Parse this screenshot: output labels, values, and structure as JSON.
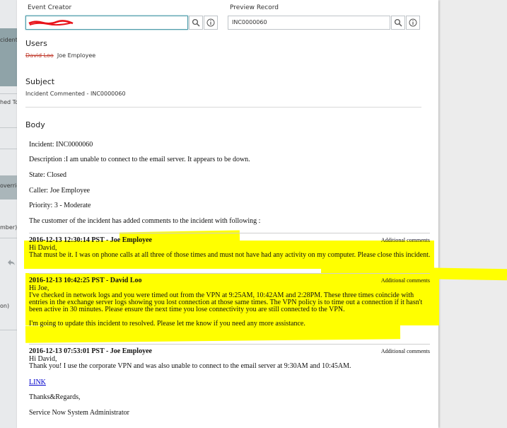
{
  "background": {
    "fragments": [
      "cident",
      "hed To",
      "overrid",
      "mber)",
      "on)"
    ]
  },
  "event_creator": {
    "label": "Event Creator",
    "value": ""
  },
  "preview_record": {
    "label": "Preview Record",
    "value": "INC0000060"
  },
  "icons": {
    "search": "search-icon",
    "info": "info-icon",
    "reply": "reply-arrow-icon"
  },
  "users": {
    "heading": "Users",
    "removed_user": "David Loo",
    "user": "Joe Employee"
  },
  "subject": {
    "heading": "Subject",
    "text": "Incident Commented - INC0000060"
  },
  "body": {
    "heading": "Body",
    "lines": [
      "Incident: INC0000060",
      "Description :I am unable to connect to the email server. It appears to be down.",
      "State: Closed",
      "Caller: Joe Employee",
      "Priority: 3 - Moderate",
      "The customer of the incident has added comments to the incident with following :"
    ],
    "comments": [
      {
        "header": "2016-12-13 12:30:14 PST - Joe Employee",
        "type": "Additional comments",
        "text": "Hi David,\nThat must be it. I was on phone calls at all three of those times and must not have had any activity on my computer. Please close this incident."
      },
      {
        "header": "2016-12-13 10:42:25 PST - David Loo",
        "type": "Additional comments",
        "text": "Hi Joe,\nI've checked in network logs and you were timed out from the VPN at 9:25AM, 10:42AM and 2:28PM. These three times coincide with entries in the exchange server logs showing you lost connection at those same times. The VPN policy is to time out a connection if it hasn't been active in 30 minutes. Please ensure the next time you lose connectivity you are still connected to the VPN.\n\nI'm going to update this incident to resolved. Please let me know if you need any more assistance."
      },
      {
        "header": "2016-12-13 07:53:01 PST - Joe Employee",
        "type": "Additional comments",
        "text": "Hi David,\nThank you! I use the corporate VPN and was also unable to connect to the email server at 9:30AM and 10:45AM."
      }
    ],
    "link": "LINK",
    "signoff": "Thanks&Regards,",
    "signature": "Service Now System Administrator"
  },
  "colors": {
    "highlight": "#ffff00",
    "link": "#0000cc",
    "focus_border": "#4a9aa8",
    "scribble": "#e8141b"
  }
}
